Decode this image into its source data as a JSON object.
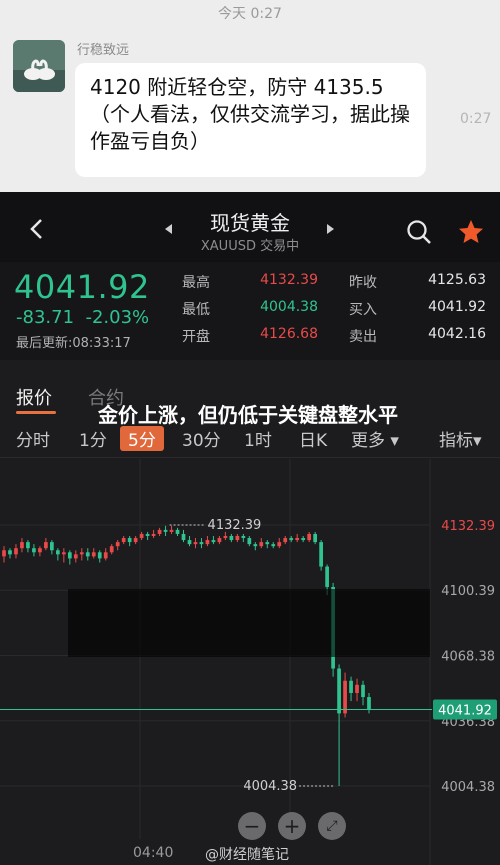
{
  "chat": {
    "time": "今天 0:27",
    "sender": "行稳致远",
    "message": "4120 附近轻仓空，防守 4135.5（个人看法，仅供交流学习，据此操作盈亏自负）",
    "message_time": "0:27"
  },
  "header": {
    "title": "现货黄金",
    "subtitle": "XAUUSD 交易中",
    "back_icon": "chevron-left-icon",
    "search_icon": "search-icon",
    "favorite_icon": "star-icon",
    "star_color": "#f05a2a"
  },
  "quote": {
    "price": "4041.92",
    "change": "-83.71",
    "change_pct": "-2.03%",
    "last_update": "最后更新:08:33:17",
    "stats": [
      {
        "label": "最高",
        "value": "4132.39",
        "tone": "red"
      },
      {
        "label": "昨收",
        "value": "4125.63",
        "tone": "white"
      },
      {
        "label": "最低",
        "value": "4004.38",
        "tone": "green"
      },
      {
        "label": "买入",
        "value": "4041.92",
        "tone": "white"
      },
      {
        "label": "开盘",
        "value": "4126.68",
        "tone": "red"
      },
      {
        "label": "卖出",
        "value": "4042.16",
        "tone": "white"
      }
    ]
  },
  "tabs": {
    "active": "报价",
    "other": "合约"
  },
  "periods": [
    "分时",
    "1分",
    "5分",
    "30分",
    "1时",
    "日K",
    "更多",
    "指标"
  ],
  "active_period": "5分",
  "overlay": {
    "caption": "金价上涨，但仍低于关键盘整水平"
  },
  "chart_data": {
    "type": "candlestick",
    "y_ticks": [
      "4132.39",
      "4100.39",
      "4068.38",
      "4036.38",
      "4004.38"
    ],
    "current_price": "4041.92",
    "high_marker": "4132.39",
    "low_marker": "4004.38",
    "ylim": [
      4004.38,
      4132.39
    ],
    "up_color": "#e84a4a",
    "down_color": "#2fc48f",
    "candles": [
      [
        4117,
        4120,
        4114,
        4122
      ],
      [
        4120,
        4118,
        4116,
        4121
      ],
      [
        4118,
        4121,
        4116,
        4123
      ],
      [
        4121,
        4124,
        4119,
        4126
      ],
      [
        4124,
        4121,
        4119,
        4125
      ],
      [
        4121,
        4119,
        4117,
        4123
      ],
      [
        4119,
        4121,
        4117,
        4122
      ],
      [
        4121,
        4124,
        4120,
        4126
      ],
      [
        4124,
        4120,
        4118,
        4125
      ],
      [
        4120,
        4118,
        4115,
        4121
      ],
      [
        4118,
        4119,
        4114,
        4121
      ],
      [
        4119,
        4116,
        4113,
        4120
      ],
      [
        4116,
        4118,
        4114,
        4120
      ],
      [
        4118,
        4119,
        4115,
        4121
      ],
      [
        4119,
        4117,
        4115,
        4121
      ],
      [
        4117,
        4119,
        4116,
        4121
      ],
      [
        4119,
        4116,
        4114,
        4120
      ],
      [
        4116,
        4119,
        4115,
        4121
      ],
      [
        4119,
        4122,
        4118,
        4123
      ],
      [
        4122,
        4124,
        4120,
        4125
      ],
      [
        4124,
        4126,
        4123,
        4127
      ],
      [
        4126,
        4124,
        4122,
        4127
      ],
      [
        4124,
        4126,
        4123,
        4127
      ],
      [
        4126,
        4128,
        4125,
        4129
      ],
      [
        4128,
        4127,
        4125,
        4129
      ],
      [
        4127,
        4128,
        4126,
        4130
      ],
      [
        4128,
        4130,
        4127,
        4131
      ],
      [
        4130,
        4129,
        4127,
        4132
      ],
      [
        4129,
        4130,
        4128,
        4132
      ],
      [
        4130,
        4128,
        4127,
        4131
      ],
      [
        4128,
        4125,
        4124,
        4130
      ],
      [
        4125,
        4123,
        4122,
        4127
      ],
      [
        4123,
        4124,
        4121,
        4126
      ],
      [
        4124,
        4123,
        4121,
        4126
      ],
      [
        4123,
        4125,
        4122,
        4127
      ],
      [
        4125,
        4124,
        4123,
        4127
      ],
      [
        4124,
        4126,
        4123,
        4127
      ],
      [
        4126,
        4127,
        4125,
        4129
      ],
      [
        4127,
        4125,
        4124,
        4128
      ],
      [
        4125,
        4127,
        4124,
        4128
      ],
      [
        4127,
        4126,
        4124,
        4128
      ],
      [
        4126,
        4123,
        4122,
        4127
      ],
      [
        4123,
        4122,
        4120,
        4124
      ],
      [
        4122,
        4124,
        4121,
        4126
      ],
      [
        4124,
        4123,
        4121,
        4125
      ],
      [
        4123,
        4122,
        4121,
        4124
      ],
      [
        4122,
        4124,
        4121,
        4126
      ],
      [
        4124,
        4126,
        4123,
        4127
      ],
      [
        4126,
        4125,
        4124,
        4127
      ],
      [
        4125,
        4126,
        4124,
        4128
      ],
      [
        4126,
        4125,
        4124,
        4127
      ],
      [
        4125,
        4128,
        4124,
        4129
      ],
      [
        4128,
        4124,
        4123,
        4129
      ],
      [
        4124,
        4112,
        4110,
        4125
      ],
      [
        4112,
        4102,
        4098,
        4113
      ],
      [
        4102,
        4062,
        4058,
        4104
      ],
      [
        4062,
        4040,
        4004.38,
        4064
      ],
      [
        4040,
        4056,
        4038,
        4060
      ],
      [
        4056,
        4050,
        4046,
        4058
      ],
      [
        4050,
        4054,
        4046,
        4057
      ],
      [
        4054,
        4048,
        4044,
        4056
      ],
      [
        4048,
        4042,
        4040,
        4050
      ]
    ]
  },
  "footer": {
    "time_label": "04:40",
    "watermark": "@财经随笔记",
    "zoom_out_icon": "zoom-out-icon",
    "zoom_in_icon": "zoom-in-icon",
    "fullscreen_icon": "fullscreen-icon"
  }
}
